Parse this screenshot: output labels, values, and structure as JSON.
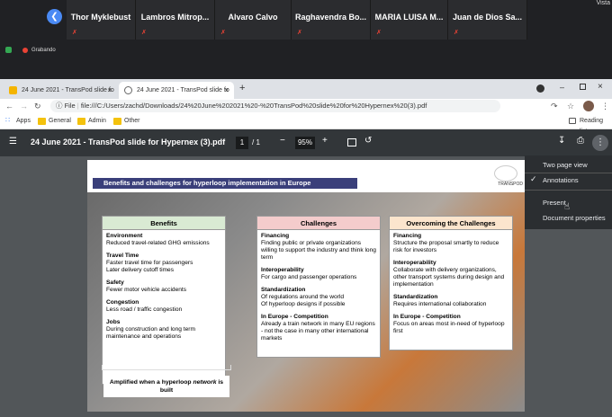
{
  "meeting": {
    "participants": [
      "Thor Myklebust",
      "Lambros  Mitrop...",
      "Alvaro Calvo",
      "Raghavendra  Bo...",
      "MARIA LUISA M...",
      "Juan de Dios Sa..."
    ],
    "view_label": "Vista",
    "recording_label": "Grabando"
  },
  "tabs": [
    {
      "title": "24 June 2021 - TransPod slide fo",
      "close": "×"
    },
    {
      "title": "24 June 2021 - TransPod slide fo",
      "close": "×"
    }
  ],
  "new_tab": "+",
  "address": {
    "scheme": "File",
    "url": "file:///C:/Users/zachd/Downloads/24%20June%202021%20-%20TransPod%20slide%20for%20Hypernex%20(3).pdf"
  },
  "bookmarks": [
    "Apps",
    "General",
    "Admin",
    "Other"
  ],
  "reading_list": "Reading list",
  "pdf": {
    "title": "24 June 2021 - TransPod slide for Hypernex (3).pdf",
    "page_current": "1",
    "page_total": "/  1",
    "zoom": "95%"
  },
  "slide": {
    "banner": "Benefits and challenges for hyperloop implementation in Europe",
    "logo_text": "TRANSPOD",
    "columns": [
      {
        "header": "Benefits",
        "color": "#d9ead3",
        "items": [
          {
            "title": "Environment",
            "text": "Reduced travel-related GHG emissions"
          },
          {
            "title": "Travel Time",
            "text": "Faster travel time for passengers\nLater delivery cutoff times"
          },
          {
            "title": "Safety",
            "text": "Fewer motor vehicle accidents"
          },
          {
            "title": "Congestion",
            "text": "Less road / traffic congestion"
          },
          {
            "title": "Jobs",
            "text": "During construction and long term maintenance and operations"
          }
        ]
      },
      {
        "header": "Challenges",
        "color": "#f4cccc",
        "items": [
          {
            "title": "Financing",
            "text": "Finding public or private organizations willing to support the industry and think long term"
          },
          {
            "title": "Interoperability",
            "text": "For cargo and passenger operations"
          },
          {
            "title": "Standardization",
            "text": "Of regulations around the world\nOf hyperloop designs if possible"
          },
          {
            "title": "In Europe - Competition",
            "text": "Already a train network in many EU regions - not the case in many other international markets"
          }
        ]
      },
      {
        "header": "Overcoming the Challenges",
        "color": "#fce5cd",
        "items": [
          {
            "title": "Financing",
            "text": "Structure the proposal smartly to reduce risk for investors"
          },
          {
            "title": "Interoperability",
            "text": "Collaborate with delivery organizations, other transport systems during design and implementation"
          },
          {
            "title": "Standardization",
            "text": "Requires international collaboration"
          },
          {
            "title": "In Europe - Competition",
            "text": "Focus on areas most in-need of hyperloop first"
          }
        ]
      }
    ],
    "amplified_pre": "Amplified when a hyperloop ",
    "amplified_em": "network",
    "amplified_post": " is built"
  },
  "menu": {
    "items": [
      "Two page view",
      "Annotations",
      "Present",
      "Document properties"
    ],
    "checked": "Annotations"
  }
}
